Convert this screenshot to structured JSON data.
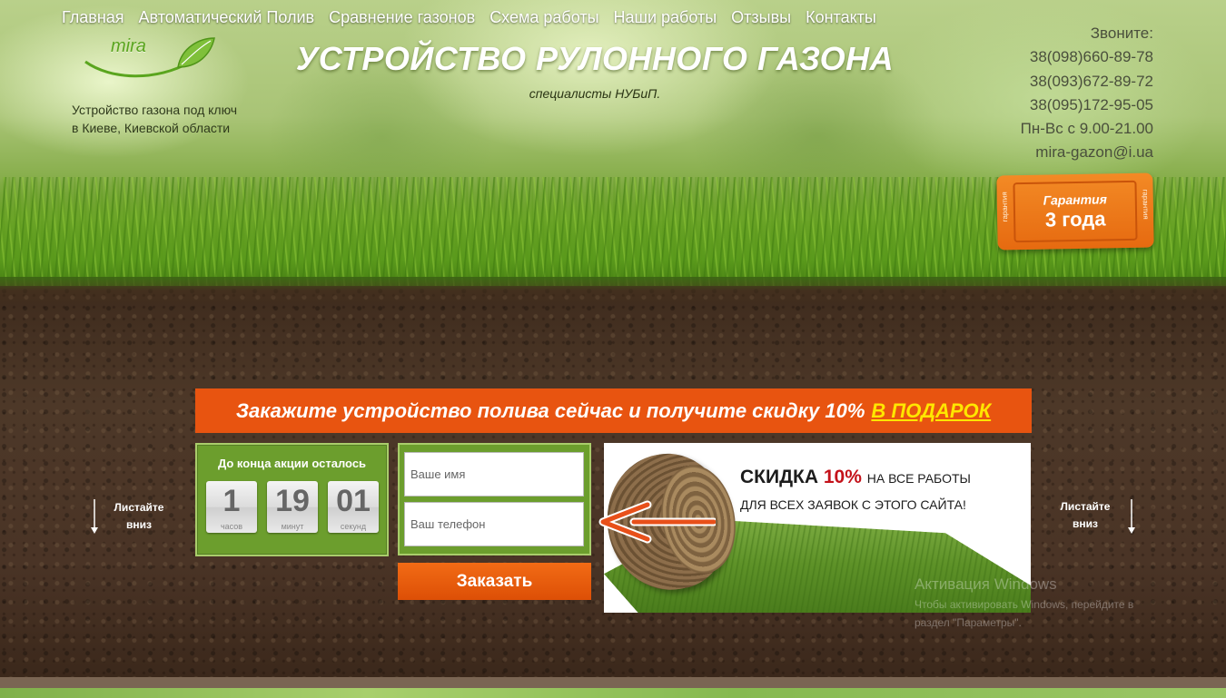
{
  "nav": {
    "items": [
      "Главная",
      "Автоматический Полив",
      "Сравнение газонов",
      "Схема работы",
      "Наши работы",
      "Отзывы",
      "Контакты"
    ]
  },
  "logo": {
    "text": "mira"
  },
  "tagline": {
    "line1": "Устройство газона под ключ",
    "line2": "в Киеве, Киевской области"
  },
  "header": {
    "title": "УСТРОЙСТВО РУЛОННОГО ГАЗОНА",
    "subtitle": "специалисты НУБиП."
  },
  "contacts": {
    "label": "Звоните:",
    "phones": [
      "38(098)660-89-78",
      "38(093)672-89-72",
      "38(095)172-95-05"
    ],
    "hours": "Пн-Вс с 9.00-21.00",
    "email": "mira-gazon@i.ua"
  },
  "guarantee": {
    "title": "Гарантия",
    "value": "3 года",
    "side": "гарантия"
  },
  "promo": {
    "text": "Закажите устройство полива сейчас и получите скидку 10%",
    "gift": "В ПОДАРОК"
  },
  "countdown": {
    "title": "До конца акции осталось",
    "units": [
      {
        "value": "1",
        "label": "часов"
      },
      {
        "value": "19",
        "label": "минут"
      },
      {
        "value": "01",
        "label": "секунд"
      }
    ]
  },
  "form": {
    "name_placeholder": "Ваше имя",
    "phone_placeholder": "Ваш телефон",
    "submit_label": "Заказать"
  },
  "discount": {
    "word": "СКИДКА",
    "percent": "10%",
    "suffix": "НА ВСЕ РАБОТЫ",
    "line2": "ДЛЯ ВСЕХ ЗАЯВОК С ЭТОГО САЙТА!"
  },
  "scroll_hint": {
    "line1": "Листайте",
    "line2": "вниз"
  },
  "windows_watermark": {
    "title": "Активация Windows",
    "line1": "Чтобы активировать Windows, перейдите в",
    "line2": "раздел \"Параметры\"."
  },
  "colors": {
    "accent_orange": "#e85410",
    "promo_yellow": "#ffe600",
    "panel_green": "#6c9e2d",
    "discount_red": "#c4121a"
  }
}
